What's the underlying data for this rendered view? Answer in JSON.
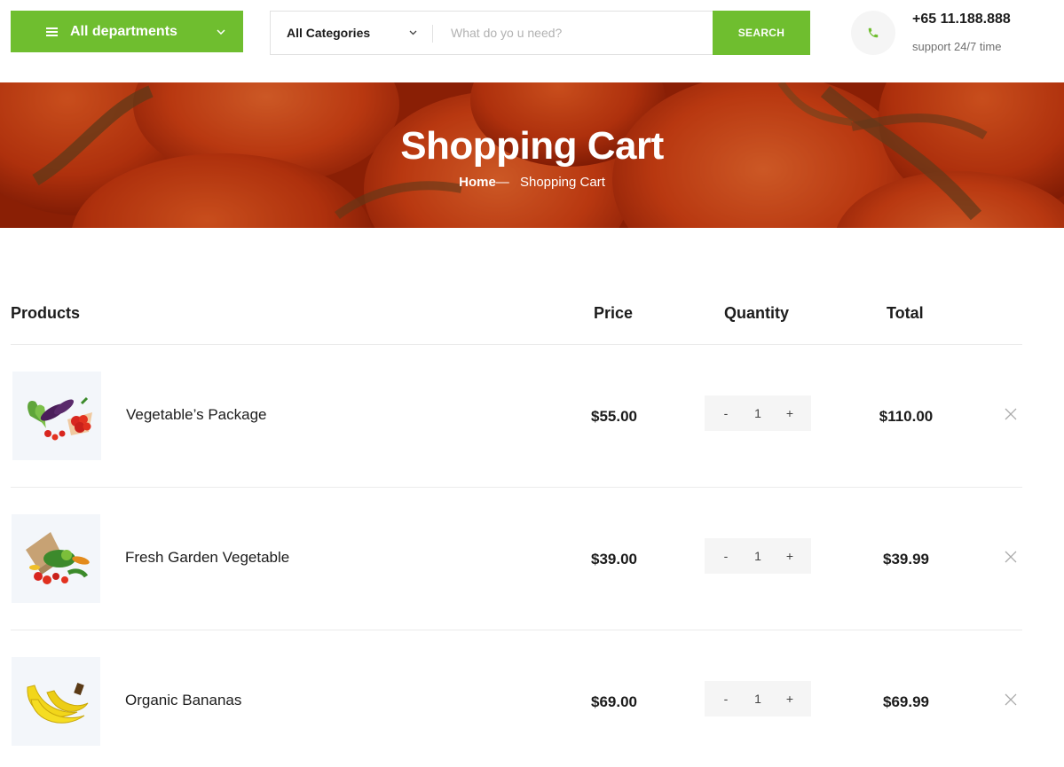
{
  "header": {
    "departments_label": "All departments",
    "category_selected": "All Categories",
    "search_placeholder": "What do yo u need?",
    "search_button": "SEARCH",
    "phone_number": "+65 11.188.888",
    "support_text": "support 24/7 time"
  },
  "hero": {
    "title": "Shopping Cart",
    "breadcrumb_home": "Home",
    "breadcrumb_separator": "—",
    "breadcrumb_current": "Shopping Cart"
  },
  "table": {
    "headers": {
      "products": "Products",
      "price": "Price",
      "quantity": "Quantity",
      "total": "Total"
    },
    "rows": [
      {
        "name": "Vegetable’s Package",
        "price": "$55.00",
        "qty": "1",
        "total": "$110.00"
      },
      {
        "name": "Fresh Garden Vegetable",
        "price": "$39.00",
        "qty": "1",
        "total": "$39.99"
      },
      {
        "name": "Organic Bananas",
        "price": "$69.00",
        "qty": "1",
        "total": "$69.99"
      }
    ],
    "qty_minus": "-",
    "qty_plus": "+"
  },
  "colors": {
    "accent": "#6fbe2f",
    "hero": "#9a2a0c"
  },
  "icons": [
    "menu-icon",
    "chevron-down-icon",
    "phone-icon",
    "close-icon"
  ]
}
